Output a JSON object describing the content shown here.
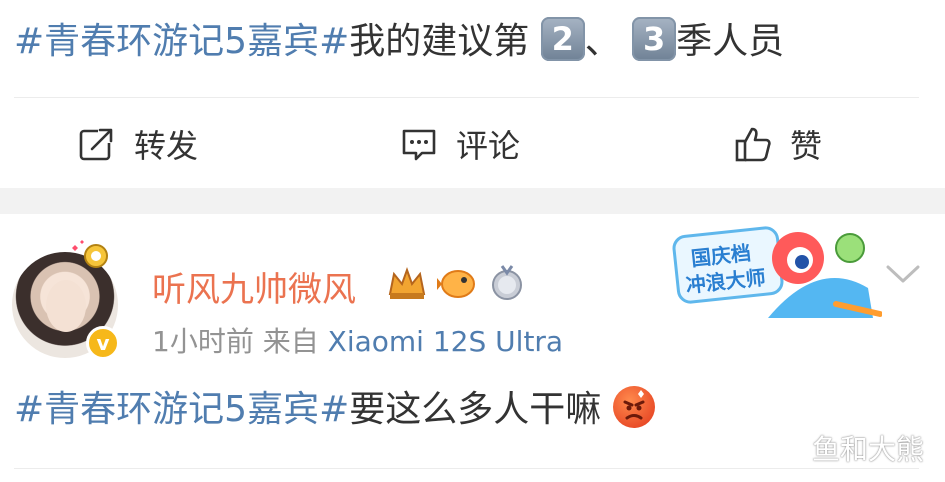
{
  "post": {
    "hashtag": "#青春环游记5嘉宾#",
    "text_before": "我的建议第",
    "num_a": "2",
    "sep": "、",
    "num_b": "3",
    "text_after": "季人员"
  },
  "actions": {
    "repost_label": "转发",
    "comment_label": "评论",
    "like_label": "赞"
  },
  "comment": {
    "username": "听风九帅微风",
    "time": "1小时前",
    "from_label": "来自",
    "device": "Xiaomi 12S Ultra",
    "hashtag": "#青春环游记5嘉宾#",
    "text": "要这么多人干嘛",
    "badge_icons": [
      "crown-badge-icon",
      "pufferfish-badge-icon",
      "medal-badge-icon"
    ],
    "banner_text": [
      "国庆档",
      "冲浪大师"
    ],
    "verified_mark": "v"
  },
  "watermark": "鱼和大熊",
  "colors": {
    "link": "#507daf",
    "username": "#eb7350",
    "meta": "#939393"
  }
}
